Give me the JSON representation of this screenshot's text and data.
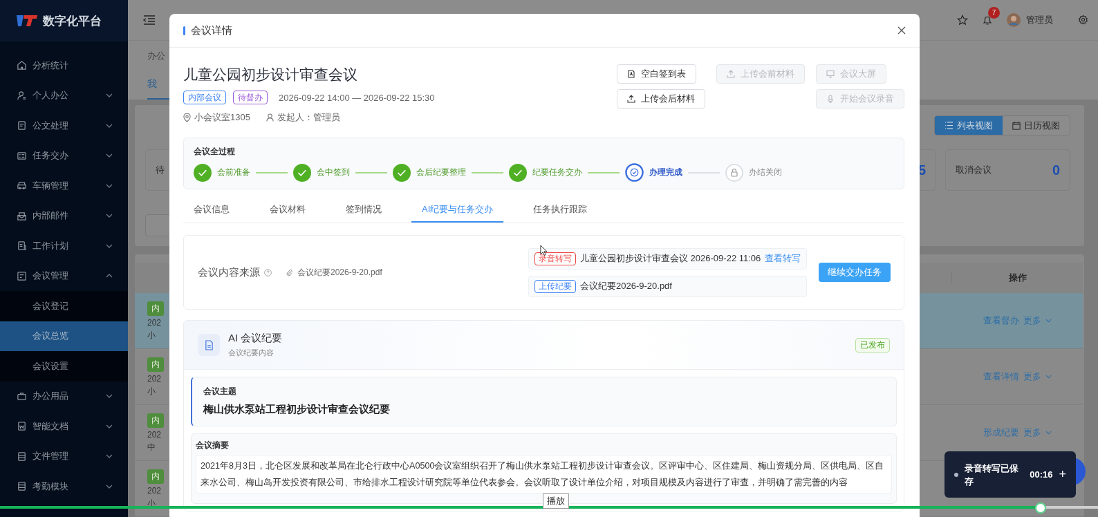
{
  "sidebar": {
    "logo": "数字化平台",
    "items": [
      {
        "label": "分析统计",
        "expandable": false
      },
      {
        "label": "个人办公",
        "expandable": true,
        "expanded": false
      },
      {
        "label": "公文处理",
        "expandable": true,
        "expanded": false
      },
      {
        "label": "任务交办",
        "expandable": true,
        "expanded": false
      },
      {
        "label": "车辆管理",
        "expandable": true,
        "expanded": false
      },
      {
        "label": "内部邮件",
        "expandable": true,
        "expanded": false
      },
      {
        "label": "工作计划",
        "expandable": true,
        "expanded": false
      },
      {
        "label": "会议管理",
        "expandable": true,
        "expanded": true,
        "children": [
          {
            "label": "会议登记",
            "selected": false
          },
          {
            "label": "会议总览",
            "selected": true
          },
          {
            "label": "会议设置",
            "selected": false
          }
        ]
      },
      {
        "label": "办公用品",
        "expandable": true,
        "expanded": false
      },
      {
        "label": "智能文档",
        "expandable": true,
        "expanded": false
      },
      {
        "label": "文件管理",
        "expandable": true,
        "expanded": false
      },
      {
        "label": "考勤模块",
        "expandable": true,
        "expanded": false
      }
    ]
  },
  "header": {
    "notifications": "7",
    "user": "管理员"
  },
  "page": {
    "breadcrumb": "办公",
    "tabs": [
      {
        "label": "我",
        "selected": true
      }
    ],
    "view_toggle": [
      {
        "label": "列表视图",
        "selected": true
      },
      {
        "label": "日历视图",
        "selected": false
      }
    ],
    "stats": [
      {
        "label": "待"
      },
      {
        "value": "5"
      },
      {
        "label": "取消会议",
        "value": "0"
      }
    ],
    "table": {
      "columns": [
        {
          "label": "操作"
        }
      ],
      "rows": [
        {
          "tag": "内",
          "date": "202",
          "place": "小",
          "actions": [
            "查看督办",
            "更多"
          ],
          "selected": true
        },
        {
          "tag": "内",
          "date": "202",
          "place": "小",
          "actions": [
            "查看详情",
            "更多"
          ],
          "selected": false
        },
        {
          "tag": "内",
          "date": "202",
          "place": "中",
          "actions": [
            "形成纪要",
            "更多"
          ],
          "selected": false
        },
        {
          "tag": "内",
          "date": "202",
          "place": "小",
          "selected": false
        }
      ]
    }
  },
  "modal": {
    "title": "会议详情",
    "name": "儿童公园初步设计审查会议",
    "tags": [
      {
        "label": "内部会议",
        "color": "#3b82f6"
      },
      {
        "label": "待督办",
        "color": "#9b59d6"
      }
    ],
    "time": "2026-09-22 14:00 — 2026-09-22 15:30",
    "location": "小会议室1305",
    "organizer": "发起人：管理员",
    "actions": [
      {
        "label": "空白签到表",
        "disabled": false
      },
      {
        "label": "上传会前材料",
        "disabled": true
      },
      {
        "label": "会议大屏",
        "disabled": true
      },
      {
        "label": "上传会后材料",
        "disabled": false
      },
      {
        "label": "开始会议录音",
        "disabled": true
      }
    ],
    "process": {
      "title": "会议全过程",
      "steps": [
        {
          "label": "会前准备",
          "kind": "done"
        },
        {
          "label": "会中签到",
          "kind": "done"
        },
        {
          "label": "会后纪要整理",
          "kind": "done"
        },
        {
          "label": "纪要任务交办",
          "kind": "done"
        },
        {
          "label": "办理完成",
          "kind": "current"
        },
        {
          "label": "办结关闭",
          "kind": "locked"
        }
      ]
    },
    "tabs": [
      {
        "label": "会议信息",
        "selected": false
      },
      {
        "label": "会议材料",
        "selected": false
      },
      {
        "label": "签到情况",
        "selected": false
      },
      {
        "label": "AI纪要与任务交办",
        "selected": true
      },
      {
        "label": "任务执行跟踪",
        "selected": false
      }
    ],
    "source": {
      "label": "会议内容来源",
      "file": "会议纪要2026-9-20.pdf",
      "entries": [
        {
          "tag": "录音转写",
          "color": "#ef4444",
          "text": "儿童公园初步设计审查会议 2026-09-22 11:06",
          "link": "查看转写"
        },
        {
          "tag": "上传纪要",
          "color": "#3b82f6",
          "text": "会议纪要2026-9-20.pdf"
        }
      ],
      "button": "继续交办任务"
    },
    "minutes": {
      "title": "AI 会议纪要",
      "subtitle": "会议纪要内容",
      "status": "已发布",
      "topic_label": "会议主题",
      "topic": "梅山供水泵站工程初步设计审查会议纪要",
      "abstract_label": "会议摘要",
      "abstract": "2021年8月3日，北仑区发展和改革局在北仑行政中心A0500会议室组织召开了梅山供水泵站工程初步设计审查会议。区评审中心、区住建局、梅山资规分局、区供电局、区自来水公司、梅山岛开发投资有限公司、市给排水工程设计研究院等单位代表参会。会议听取了设计单位介绍，对项目规模及内容进行了审查，并明确了需完善的内容"
    }
  },
  "toast": {
    "text": "录音转写已保存",
    "time": "00:16",
    "action": "+"
  },
  "video": {
    "tooltip": "播放",
    "level": 0.948
  }
}
